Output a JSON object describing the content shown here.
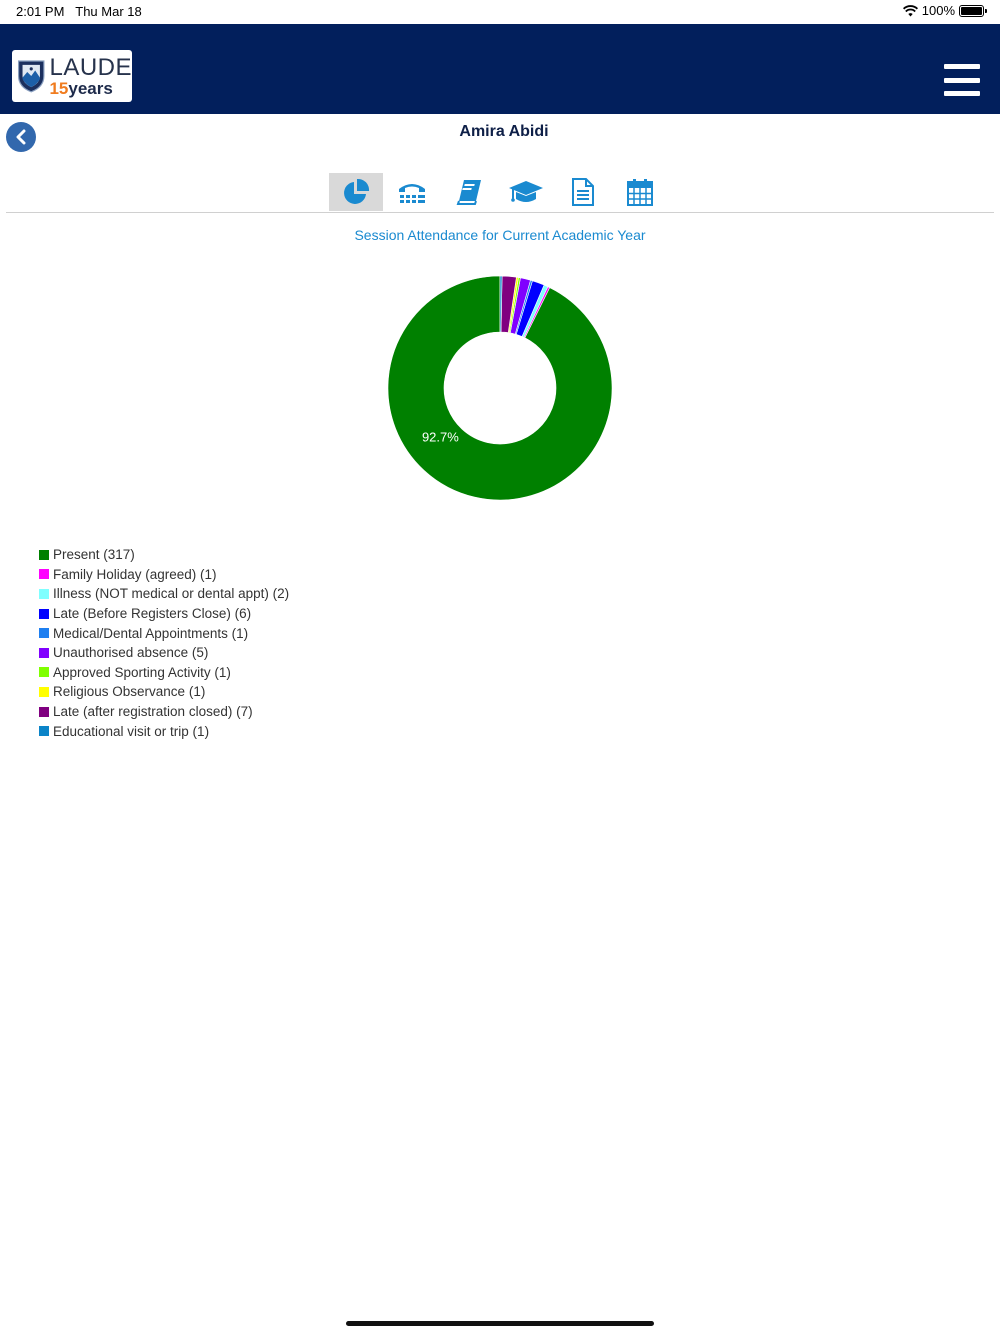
{
  "status_bar": {
    "time": "2:01 PM",
    "date": "Thu Mar 18",
    "battery": "100%"
  },
  "header": {
    "logo_main": "LAUDE",
    "logo_number": "15",
    "logo_word": "years",
    "brand_color": "#021f5c"
  },
  "page": {
    "title": "Amira Abidi"
  },
  "tabs": [
    {
      "icon": "pie-chart-icon",
      "active": true
    },
    {
      "icon": "telephone-icon",
      "active": false
    },
    {
      "icon": "book-icon",
      "active": false
    },
    {
      "icon": "graduation-cap-icon",
      "active": false
    },
    {
      "icon": "document-icon",
      "active": false
    },
    {
      "icon": "calendar-icon",
      "active": false
    }
  ],
  "chart_data": {
    "type": "pie",
    "title": "Session Attendance for Current Academic Year",
    "donut": true,
    "start_angle_deg": 0,
    "slices": [
      {
        "label": "Present",
        "value": 317,
        "color": "#008000"
      },
      {
        "label": "Family Holiday (agreed)",
        "value": 1,
        "color": "#ff00ff"
      },
      {
        "label": "Illness (NOT medical or dental appt)",
        "value": 2,
        "color": "#7fffff"
      },
      {
        "label": "Late (Before Registers Close)",
        "value": 6,
        "color": "#0000ff"
      },
      {
        "label": "Medical/Dental Appointments",
        "value": 1,
        "color": "#1e7ff0"
      },
      {
        "label": "Unauthorised absence",
        "value": 5,
        "color": "#8000ff"
      },
      {
        "label": "Approved Sporting Activity",
        "value": 1,
        "color": "#80ff00"
      },
      {
        "label": "Religious Observance",
        "value": 1,
        "color": "#ffff00"
      },
      {
        "label": "Late (after registration closed)",
        "value": 7,
        "color": "#800080"
      },
      {
        "label": "Educational visit or trip",
        "value": 1,
        "color": "#0b84c8"
      }
    ],
    "data_labels": [
      {
        "slice": 0,
        "text": "92.7%"
      }
    ],
    "legend_position": "bottom-left"
  },
  "legend_items": [
    "Present (317)",
    "Family Holiday (agreed) (1)",
    "Illness (NOT medical or dental appt) (2)",
    "Late (Before Registers Close) (6)",
    "Medical/Dental Appointments (1)",
    "Unauthorised absence (5)",
    "Approved Sporting Activity (1)",
    "Religious Observance (1)",
    "Late (after registration closed) (7)",
    "Educational visit or trip (1)"
  ]
}
